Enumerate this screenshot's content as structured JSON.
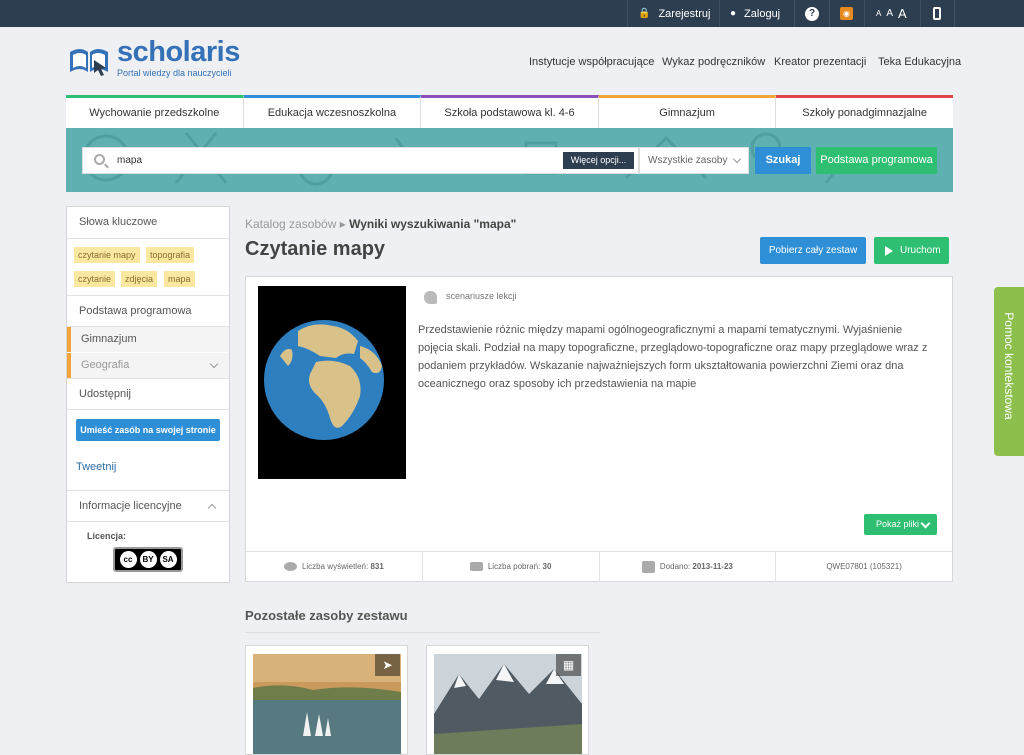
{
  "topbar": {
    "register": "Zarejestruj",
    "login": "Zaloguj",
    "font_small": "A",
    "font_medium": "A",
    "font_large": "A"
  },
  "brand": {
    "name": "scholaris",
    "tagline": "Portal wiedzy dla nauczycieli",
    "color": "#3571b6"
  },
  "topnav": [
    "Instytucje współpracujące",
    "Wykaz podręczników",
    "Kreator prezentacji",
    "Teka Edukacyjna"
  ],
  "levels": [
    {
      "label": "Wychowanie przedszkolne",
      "color": "#2fbf72"
    },
    {
      "label": "Edukacja wczesnoszkolna",
      "color": "#2f8fd6"
    },
    {
      "label": "Szkoła podstawowa kl. 4-6",
      "color": "#8a4fb8"
    },
    {
      "label": "Gimnazjum",
      "color": "#f0a53a"
    },
    {
      "label": "Szkoły ponadgimnazjalne",
      "color": "#e04646"
    }
  ],
  "search": {
    "value": "mapa",
    "more_options": "Więcej opcji...",
    "scope": "Wszystkie zasoby",
    "submit": "Szukaj",
    "core_curriculum": "Podstawa programowa"
  },
  "sidebar": {
    "keywords_title": "Słowa kluczowe",
    "tags": [
      "czytanie mapy",
      "topografia",
      "czytanie",
      "zdjęcia",
      "mapa"
    ],
    "curriculum_title": "Podstawa programowa zasobu",
    "level": "Gimnazjum",
    "subject": "Geografia",
    "share": "Udostępnij",
    "embed_button": "Umieść zasób na swojej stronie",
    "tweet": "Tweetnij",
    "license_title": "Informacje licencyjne",
    "license_label": "Licencja:",
    "cc_by": "BY",
    "cc_sa": "SA"
  },
  "breadcrumb": {
    "root": "Katalog zasobów",
    "current": "Wyniki wyszukiwania \"mapa\""
  },
  "resource": {
    "title": "Czytanie mapy",
    "download_all": "Pobierz cały zestaw",
    "run": "Uruchom",
    "type": "scenariusze lekcji",
    "description": "Przedstawienie różnic między mapami ogólnogeograficznymi a mapami tematycznymi. Wyjaśnienie pojęcia skali. Podział na mapy topograficzne, przeglądowo-topograficzne oraz mapy przeglądowe wraz z podaniem przykładów. Wskazanie najważniejszych form ukształtowania powierzchni Ziemi oraz dna oceanicznego oraz sposoby ich przedstawienia na mapie",
    "show_files": "Pokaż pliki",
    "views_label": "Liczba wyświetleń:",
    "views": "831",
    "downloads_label": "Liczba pobrań:",
    "downloads": "30",
    "added_label": "Dodano:",
    "added": "2013-11-23",
    "code": "QWE07801 (105321)"
  },
  "others": {
    "title": "Pozostałe zasoby zestawu"
  },
  "help_tab": "Pomoc kontekstowa"
}
